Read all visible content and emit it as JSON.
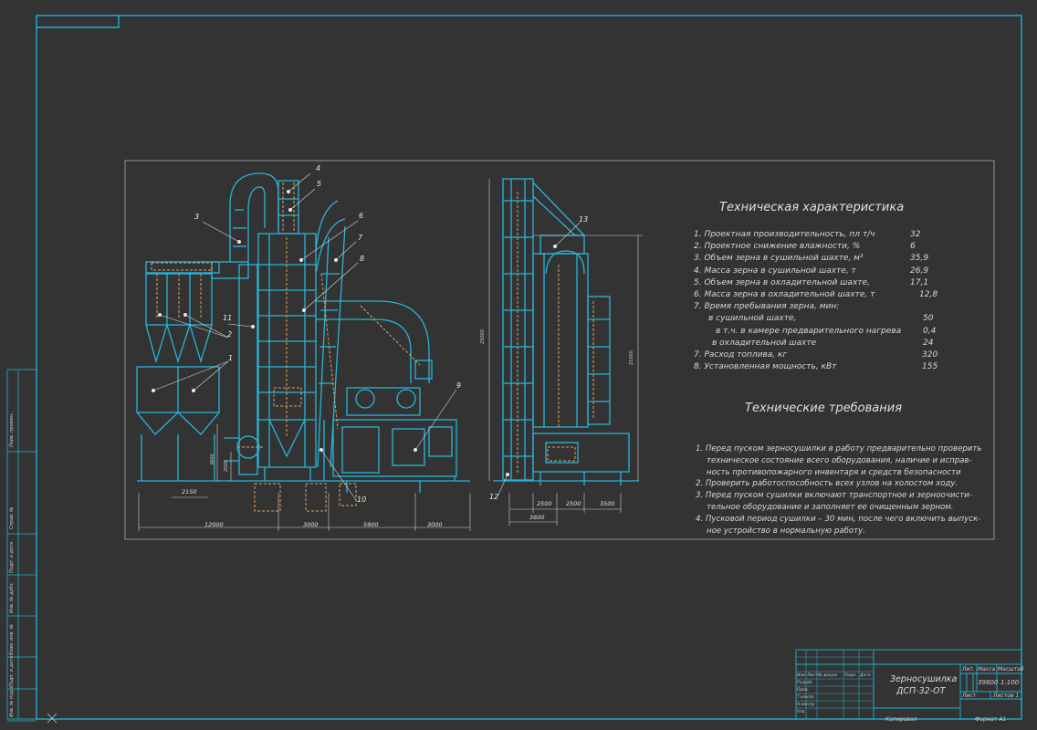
{
  "spec": {
    "title": "Техническая характеристика",
    "rows": [
      {
        "label": "1. Проектная производительность, пл т/ч",
        "value": "32"
      },
      {
        "label": "2. Проектное снижение влажности, %",
        "value": "6"
      },
      {
        "label": "3. Объем зерна в сушильной шахте, м³",
        "value": "35,9"
      },
      {
        "label": "4. Масса зерна в сушильной шахте, т",
        "value": "26,9"
      },
      {
        "label": "5. Объем зерна в охладительной шахте,",
        "value": "17,1"
      },
      {
        "label": "6. Масса зерна в охладительной шахте, т",
        "value": "12,8"
      },
      {
        "label": "7. Время пребывания зерна, мин:",
        "value": ""
      },
      {
        "label": "в сушильной шахте,",
        "value": "50"
      },
      {
        "label": "в т.ч. в камере предварительного нагрева",
        "value": "0,4"
      },
      {
        "label": "в охладительной шахте",
        "value": "24"
      },
      {
        "label": "7. Расход топлива, кг",
        "value": "320"
      },
      {
        "label": "8. Установленная мощность, кВт",
        "value": "155"
      }
    ]
  },
  "requirements": {
    "title": "Технические требования",
    "lines": [
      "1. Перед пуском зерносушилки в работу предварительно проверить",
      "техническое состояние всего оборудования, наличие и исправ-",
      "ность противопожарного инвентаря и средств безопасности",
      "2. Проверить работоспособность всех узлов на холостом ходу.",
      "3. Перед пуском сушилки включают транспортное и зерноочисти-",
      "тельное оборудование и заполняет ее очищенным зерном.",
      "4. Пусковой период сушилки – 30 мин, после чего включить выпуск-",
      "ное устройство в нормальную работу."
    ]
  },
  "callouts": [
    "1",
    "2",
    "3",
    "4",
    "5",
    "6",
    "7",
    "8",
    "9",
    "10",
    "11",
    "12",
    "13"
  ],
  "dimensions": {
    "front": [
      "12000",
      "3000",
      "5900",
      "3000",
      "2150",
      "3600",
      "2000"
    ],
    "side": [
      "2500",
      "2500",
      "3500",
      "3600",
      "25000",
      "21000"
    ]
  },
  "title_block": {
    "name_line1": "Зерносушилка",
    "name_line2": "ДСП-32-ОТ",
    "mass": "39800",
    "scale": "1:100",
    "header_cols": [
      "Лит.",
      "Масса",
      "Масштаб"
    ],
    "left_cols": [
      "Изм",
      "Лист",
      "№ докум.",
      "Подп.",
      "Дата"
    ],
    "left_rows": [
      "Разраб.",
      "Пров.",
      "Т.контр.",
      "Н.контр.",
      "Утв."
    ],
    "sheet_label": "Лист",
    "sheets_label": "Листов 1",
    "copied": "Копировал",
    "format": "Формат  А1"
  },
  "side_strip": [
    "Перв. примен.",
    "Справ. №",
    "Подп. и дата",
    "Инв. № дубл.",
    "Взам. инв. №",
    "Подп. и дата",
    "Инв. № подл."
  ],
  "colors": {
    "background": "#333333",
    "frame": "#1fb1d4",
    "drawing": "#26b6dc",
    "hidden": "#e0a060",
    "text": "#d8d8d8"
  }
}
